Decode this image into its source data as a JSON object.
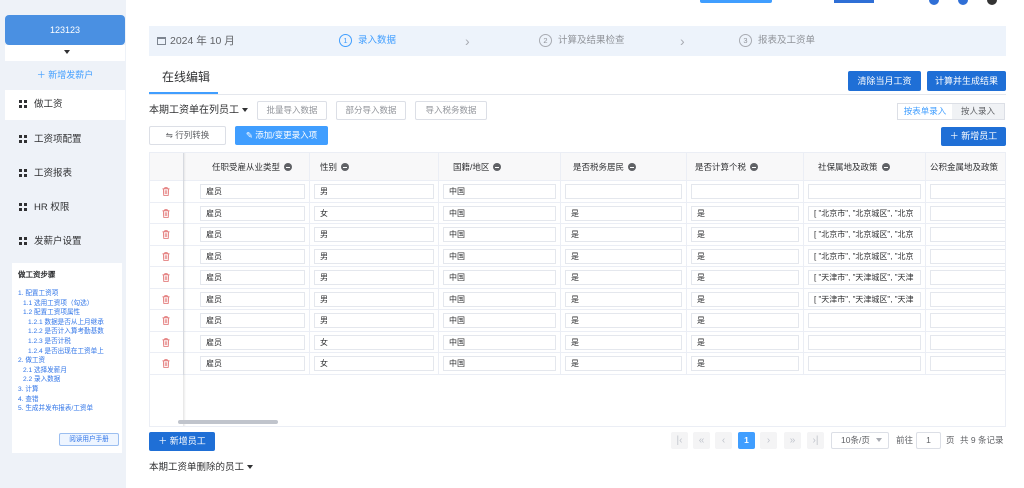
{
  "account": {
    "name": "123123"
  },
  "sidebar": {
    "add_payer": "新增发薪户",
    "items": [
      {
        "label": "做工资",
        "active": true
      },
      {
        "label": "工资项配置",
        "active": false
      },
      {
        "label": "工资报表",
        "active": false
      },
      {
        "label": "HR 权限",
        "active": false
      },
      {
        "label": "发薪户设置",
        "active": false
      }
    ],
    "steps_title": "做工资步骤",
    "steps": [
      "1. 配置工资项",
      "1.1 选用工资项（勾选）",
      "1.2 配置工资项属性",
      "1.2.1 数据是否从上月继承",
      "1.2.2 是否计入算考勤基数",
      "1.2.3 是否计税",
      "1.2.4 是否出现在工资单上",
      "2. 做工资",
      "2.1 选择发薪月",
      "2.2 录入数据",
      "3. 计算",
      "4. 查错",
      "5. 生成并发布报表/工资单"
    ],
    "manual": "阅读用户手册"
  },
  "stepper": {
    "date": "2024 年 10 月",
    "steps": [
      {
        "num": "1",
        "label": "录入数据"
      },
      {
        "num": "2",
        "label": "计算及结果检查"
      },
      {
        "num": "3",
        "label": "报表及工资单"
      }
    ]
  },
  "tab": {
    "title": "在线编辑"
  },
  "actions": {
    "clear": "清除当月工资",
    "calc": "计算并生成结果",
    "employees": "本期工资单在列员工",
    "batch_import": "批量导入数据",
    "partial_import": "部分导入数据",
    "tax_import": "导入税务数据",
    "by_table": "按表单录入",
    "by_person": "按人录入",
    "add_employee": "新增员工",
    "transform": "行列转换",
    "add_change": "添加/变更录入项"
  },
  "table": {
    "columns": [
      "任职受雇从业类型",
      "性别",
      "国籍/地区",
      "是否税务居民",
      "是否计算个税",
      "社保属地及政策",
      "公积金属地及政策"
    ],
    "rows": [
      [
        "雇员",
        "男",
        "中国",
        "",
        "",
        "",
        ""
      ],
      [
        "雇员",
        "女",
        "中国",
        "是",
        "是",
        "[ \"北京市\", \"北京城区\", \"北京",
        ""
      ],
      [
        "雇员",
        "男",
        "中国",
        "是",
        "是",
        "[ \"北京市\", \"北京城区\", \"北京",
        ""
      ],
      [
        "雇员",
        "男",
        "中国",
        "是",
        "是",
        "[ \"北京市\", \"北京城区\", \"北京",
        ""
      ],
      [
        "雇员",
        "男",
        "中国",
        "是",
        "是",
        "[ \"天津市\", \"天津城区\", \"天津",
        ""
      ],
      [
        "雇员",
        "男",
        "中国",
        "是",
        "是",
        "[ \"天津市\", \"天津城区\", \"天津",
        ""
      ],
      [
        "雇员",
        "男",
        "中国",
        "是",
        "是",
        "",
        ""
      ],
      [
        "雇员",
        "女",
        "中国",
        "是",
        "是",
        "",
        ""
      ],
      [
        "雇员",
        "女",
        "中国",
        "是",
        "是",
        "",
        ""
      ]
    ]
  },
  "footer": {
    "add_employee": "新增员工",
    "removed": "本期工资单删除的员工",
    "page_current": "1",
    "page_size": "10条/页",
    "goto_prefix": "前往",
    "goto_value": "1",
    "goto_suffix": "页",
    "total": "共 9 条记录"
  }
}
